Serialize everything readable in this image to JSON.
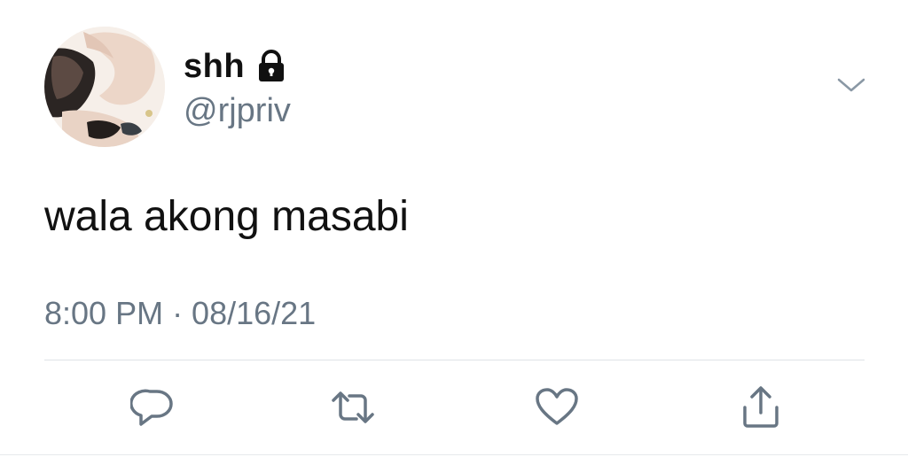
{
  "tweet": {
    "display_name": "shh",
    "handle": "@rjpriv",
    "text": "wala akong masabi",
    "timestamp": "8:00 PM · 08/16/21"
  },
  "icons": {
    "lock": "lock-icon",
    "more": "chevron-down-icon",
    "reply": "reply-icon",
    "retweet": "retweet-icon",
    "like": "heart-icon",
    "share": "share-icon"
  },
  "colors": {
    "text_primary": "#111111",
    "text_secondary": "#687684",
    "icon_gray": "#687684",
    "divider": "#dfe3e7"
  }
}
